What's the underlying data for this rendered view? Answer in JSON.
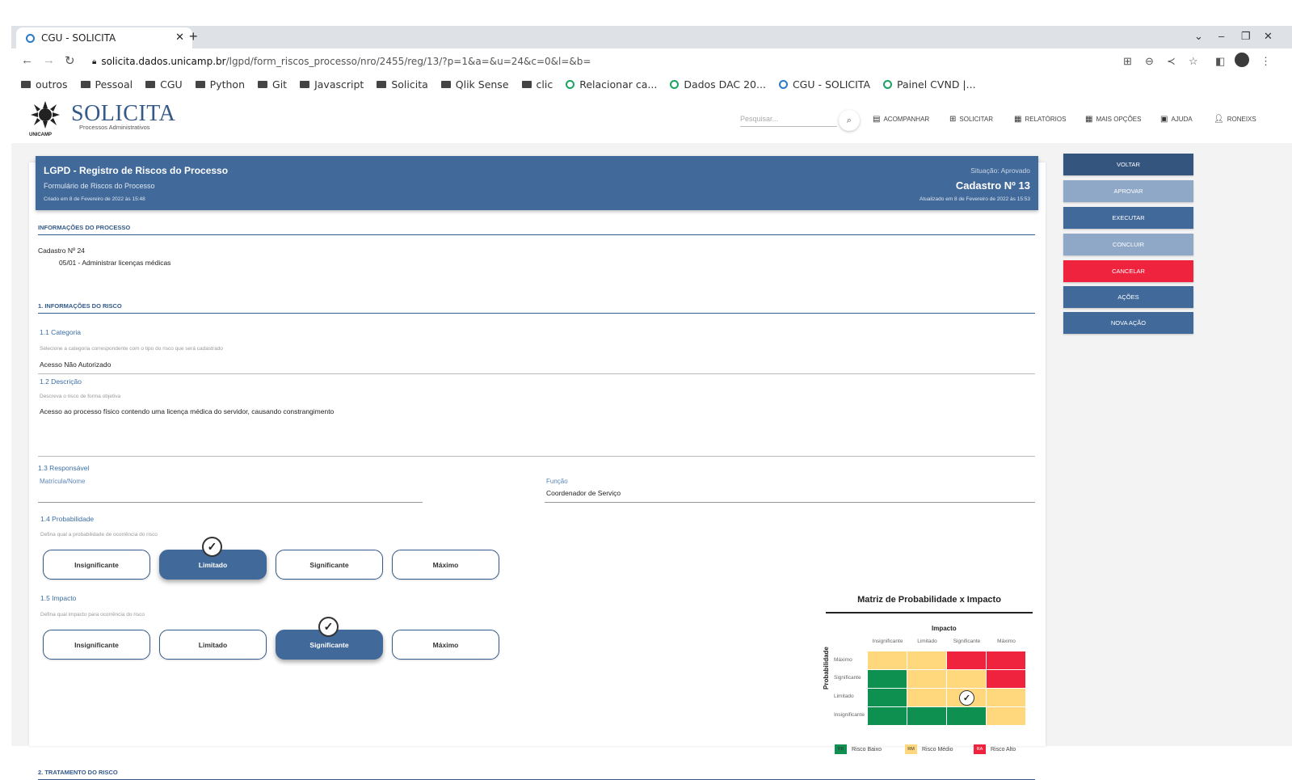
{
  "browser": {
    "tab_title": "CGU - SOLICITA",
    "url_host": "solicita.dados.unicamp.br",
    "url_path": "/lgpd/form_riscos_processo/nro/2455/reg/13/?p=1&a=&u=24&c=0&l=&b=",
    "bookmarks": [
      "outros",
      "Pessoal",
      "CGU",
      "Python",
      "Git",
      "Javascript",
      "Solicita",
      "Qlik Sense",
      "clic",
      "Relacionar ca...",
      "Dados DAC 20...",
      "CGU - SOLICITA",
      "Painel CVND |..."
    ]
  },
  "app": {
    "logo_caption": "UNICAMP",
    "name": "SOLICITA",
    "subtitle": "Processos Administrativos",
    "search_placeholder": "Pesquisar...",
    "nav": [
      "ACOMPANHAR",
      "SOLICITAR",
      "RELATÓRIOS",
      "MAIS OPÇÕES",
      "AJUDA",
      "RONEIXS"
    ]
  },
  "header": {
    "title": "LGPD - Registro de Riscos do Processo",
    "subtitle": "Formulário de Riscos do Processo",
    "created": "Criado em 8 de Fevereiro de 2022 às 15:48",
    "status": "Situação: Aprovado",
    "number": "Cadastro Nº 13",
    "updated": "Atualizado em 8 de Fevereiro de 2022 às 15:53"
  },
  "process_info": {
    "section": "INFORMAÇÕES DO PROCESSO",
    "cadastro": "Cadastro Nº 24",
    "code": "05/01",
    "desc": " - Administrar licenças médicas"
  },
  "risk": {
    "section": "1. INFORMAÇÕES DO RISCO",
    "cat_label": "1.1 Categoria",
    "cat_hint": "Selecione a categoria correspondente com o tipo do risco que será cadastrado",
    "cat_value": "Acesso Não Autorizado",
    "desc_label": "1.2 Descrição",
    "desc_hint": "Descreva o risco de forma objetiva",
    "desc_value": "Acesso ao processo físico contendo uma licença médica do servidor, causando constrangimento",
    "resp_label": "1.3 Responsável",
    "matricula_label": "Matrícula/Nome",
    "funcao_label": "Função",
    "funcao_value": "Coordenador de Serviço",
    "prob_label": "1.4 Probabilidade",
    "prob_hint": "Defina qual a probabilidade de ocorrência do risco",
    "impact_label": "1.5 Impacto",
    "impact_hint": "Defina qual impacto para ocorrência do risco",
    "options": [
      "Insignificante",
      "Limitado",
      "Significante",
      "Máximo"
    ],
    "prob_selected": "Limitado",
    "impact_selected": "Significante"
  },
  "matrix": {
    "title": "Matriz de Probabilidade x Impacto",
    "impact_head": "Impacto",
    "prob_head": "Probabilidade",
    "cols": [
      "Insignificante",
      "Limitado",
      "Significante",
      "Máximo"
    ],
    "rows": [
      "Máximo",
      "Significante",
      "Limitado",
      "Insignificante"
    ],
    "legend": [
      {
        "abbr": "RB",
        "label": "Risco Baixo"
      },
      {
        "abbr": "RM",
        "label": "Risco Médio"
      },
      {
        "abbr": "RA",
        "label": "Risco Alto"
      }
    ],
    "colors": {
      "low": "#0e9150",
      "medium": "#ffd87e",
      "high": "#f0233f"
    }
  },
  "treatment": {
    "section": "2. TRATAMENTO DO RISCO"
  },
  "actions": [
    "VOLTAR",
    "APROVAR",
    "EXECUTAR",
    "CONCLUIR",
    "CANCELAR",
    "AÇÕES",
    "NOVA AÇÃO"
  ]
}
